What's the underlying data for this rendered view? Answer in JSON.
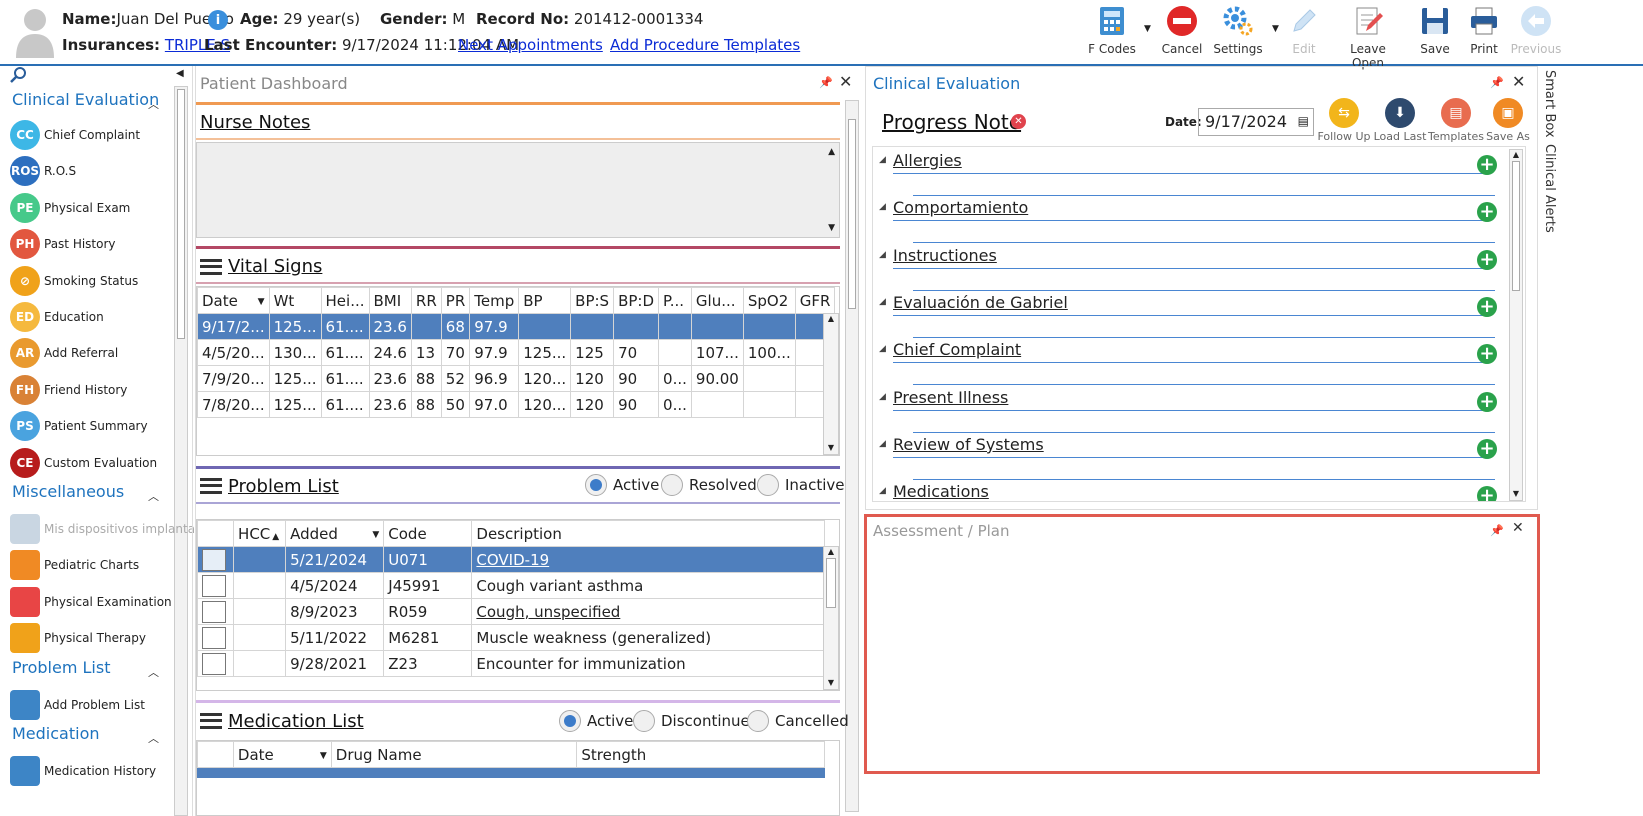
{
  "header": {
    "name_label": "Name:",
    "name": "Juan Del Pueblo",
    "age_label": "Age:",
    "age": "29 year(s)",
    "gender_label": "Gender:",
    "gender": "M",
    "record_label": "Record No:",
    "record": "201412-0001334",
    "insurances_label": "Insurances:",
    "insurance": "TRIPLE S",
    "last_enc_label": "Last Encounter:",
    "last_enc": "9/17/2024 11:12:04 AM",
    "next_appt": "Next Appointments",
    "add_proc": "Add Procedure Templates",
    "info": "i"
  },
  "toolbar": {
    "fcodes": "F Codes",
    "cancel": "Cancel",
    "settings": "Settings",
    "edit": "Edit",
    "leave_open": "Leave Open",
    "save": "Save",
    "print": "Print",
    "previous": "Previous"
  },
  "sidebar": {
    "clinical_evaluation": "Clinical Evaluation",
    "items1": [
      {
        "badge": "CC",
        "label": "Chief Complaint",
        "color": "#3db7e6"
      },
      {
        "badge": "ROS",
        "label": "R.O.S",
        "color": "#2d6fbf"
      },
      {
        "badge": "PE",
        "label": "Physical Exam",
        "color": "#46c98a"
      },
      {
        "badge": "PH",
        "label": "Past History",
        "color": "#e2573f"
      },
      {
        "badge": "⊘",
        "label": "Smoking Status",
        "color": "#f0a21a"
      },
      {
        "badge": "ED",
        "label": "Education",
        "color": "#f5b93e"
      },
      {
        "badge": "AR",
        "label": "Add Referral",
        "color": "#e99a2f"
      },
      {
        "badge": "FH",
        "label": "Friend History",
        "color": "#d98236"
      },
      {
        "badge": "PS",
        "label": "Patient Summary",
        "color": "#4aa3df"
      },
      {
        "badge": "CE",
        "label": "Custom Evaluation",
        "color": "#b71c1c"
      }
    ],
    "miscellaneous": "Miscellaneous",
    "items2": [
      {
        "badge": "",
        "label": "Mis dispositivos implanta",
        "color": "#c9d6e2"
      },
      {
        "badge": "",
        "label": "Pediatric Charts",
        "color": "#f08a24"
      },
      {
        "badge": "",
        "label": "Physical Examination",
        "color": "#e84545"
      },
      {
        "badge": "",
        "label": "Physical Therapy",
        "color": "#f0a21a"
      }
    ],
    "problem_list": "Problem List",
    "items3": [
      {
        "badge": "",
        "label": "Add Problem List",
        "color": "#3d85c6"
      }
    ],
    "medication": "Medication",
    "items4": [
      {
        "badge": "",
        "label": "Medication History",
        "color": "#3d85c6"
      }
    ]
  },
  "dashboard": {
    "title": "Patient Dashboard",
    "nurse_notes": "Nurse Notes",
    "vital_signs": "Vital Signs",
    "vital_cols": [
      "Date",
      "Wt",
      "Hei...",
      "BMI",
      "RR",
      "PR",
      "Temp",
      "BP",
      "BP:S",
      "BP:D",
      "P...",
      "Glu...",
      "SpO2",
      "GFR"
    ],
    "vital_rows": [
      [
        "9/17/2...",
        "125...",
        "61....",
        "23.6",
        "",
        "68",
        "97.9",
        "",
        "",
        "",
        "",
        "",
        "",
        ""
      ],
      [
        "4/5/20...",
        "130...",
        "61....",
        "24.6",
        "13",
        "70",
        "97.9",
        "125...",
        "125",
        "70",
        "",
        "107...",
        "100...",
        ""
      ],
      [
        "7/9/20...",
        "125...",
        "61....",
        "23.6",
        "88",
        "52",
        "96.9",
        "120...",
        "120",
        "90",
        "0...",
        "90.00",
        "",
        ""
      ],
      [
        "7/8/20...",
        "125...",
        "61....",
        "23.6",
        "88",
        "50",
        "97.0",
        "120...",
        "120",
        "90",
        "0...",
        "",
        "",
        ""
      ]
    ],
    "problem_list": "Problem List",
    "problem_filters": [
      "Active",
      "Resolved",
      "Inactive"
    ],
    "problem_cols": [
      "HCC",
      "Added",
      "Code",
      "Description"
    ],
    "problem_rows": [
      [
        "",
        "5/21/2024",
        "U071",
        "COVID-19"
      ],
      [
        "",
        "4/5/2024",
        "J45991",
        "Cough variant asthma"
      ],
      [
        "",
        "8/9/2023",
        "R059",
        "Cough, unspecified"
      ],
      [
        "",
        "5/11/2022",
        "M6281",
        "Muscle weakness (generalized)"
      ],
      [
        "",
        "9/28/2021",
        "Z23",
        "Encounter for immunization"
      ]
    ],
    "medication_list": "Medication List",
    "med_filters": [
      "Active",
      "Discontinued",
      "Cancelled"
    ],
    "med_cols": [
      "Date",
      "Drug Name",
      "Strength"
    ]
  },
  "clinical": {
    "title": "Clinical Evaluation",
    "progress_note": "Progress Note",
    "date_label": "Date:",
    "date": "9/17/2024",
    "buttons": [
      "Follow Up",
      "Load Last",
      "Templates",
      "Save As"
    ],
    "sections": [
      "Allergies",
      "Comportamiento",
      "Instructiones",
      "Evaluación de Gabriel",
      "Chief Complaint",
      "Present Illness",
      "Review of Systems",
      "Medications"
    ]
  },
  "assessment": {
    "title": "Assessment / Plan"
  },
  "right_tabs": {
    "smart_box": "Smart Box",
    "clinical_alerts": "Clinical Alerts"
  }
}
